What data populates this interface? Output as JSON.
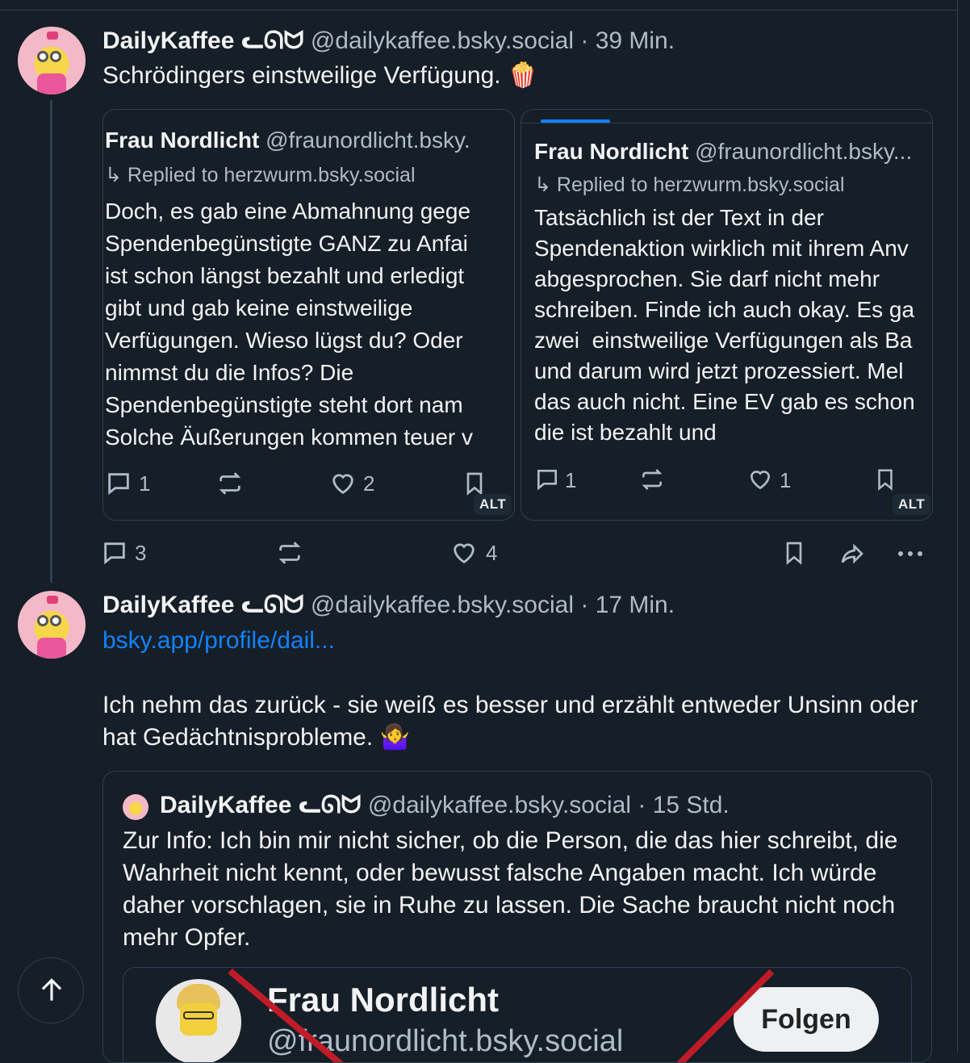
{
  "post1": {
    "author_name": "DailyKaffee ᓚᘏᗢ",
    "handle": "@dailykaffee.bsky.social",
    "separator": "·",
    "time": "39 Min.",
    "text": "Schrödingers einstweilige Verfügung.",
    "emoji": "🍿",
    "images": [
      {
        "author": "Frau Nordlicht",
        "handle": "@fraunordlicht.bsky.",
        "reply_to": "↳ Replied to herzwurm.bsky.social",
        "text": "Doch, es gab eine Abmahnung gege\nSpendenbegünstigte GANZ zu Anfai\nist schon längst bezahlt und erledigt\ngibt und gab keine einstweilige\nVerfügungen. Wieso lügst du? Oder\nnimmst du die Infos? Die\nSpendenbegünstigte steht dort nam\nSolche Äußerungen kommen teuer v",
        "replies": "1",
        "likes": "2",
        "alt": "ALT"
      },
      {
        "author": "Frau Nordlicht",
        "handle": "@fraunordlicht.bsky...",
        "reply_to": "↳ Replied to herzwurm.bsky.social",
        "text": "Tatsächlich ist der Text in der\nSpendenaktion wirklich mit ihrem Anv\nabgesprochen. Sie darf nicht mehr\nschreiben. Finde ich auch okay. Es ga\nzwei  einstweilige Verfügungen als Ba\nund darum wird jetzt prozessiert. Mel\ndas auch nicht. Eine EV gab es schon\ndie ist bezahlt und",
        "replies": "1",
        "likes": "1",
        "alt": "ALT"
      }
    ],
    "reply_count": "3",
    "like_count": "4"
  },
  "post2": {
    "author_name": "DailyKaffee ᓚᘏᗢ",
    "handle": "@dailykaffee.bsky.social",
    "separator": "·",
    "time": "17 Min.",
    "link": "bsky.app/profile/dail...",
    "text": "Ich nehm das zurück - sie weiß es besser und erzählt entweder Unsinn oder hat Gedächtnisprobleme.",
    "emoji": "🤷‍♀️",
    "quote": {
      "author_name": "DailyKaffee ᓚᘏᗢ",
      "handle": "@dailykaffee.bsky.social",
      "separator": "·",
      "time": "15 Std.",
      "text": "Zur Info: Ich bin mir nicht sicher, ob die Person, die das hier schreibt, die Wahrheit nicht kennt, oder bewusst falsche Angaben macht. Ich würde daher vorschlagen, sie in Ruhe zu lassen. Die Sache braucht nicht noch mehr Opfer.",
      "image": {
        "name": "Frau Nordlicht",
        "handle": "@fraunordlicht.bsky.social",
        "follow_label": "Folgen"
      }
    }
  },
  "colors": {
    "background": "#161e27",
    "border": "#2e4052",
    "muted_text": "#aebbc9",
    "link": "#1083fe",
    "strike": "#c01c28"
  },
  "icons": [
    "reply-icon",
    "repost-icon",
    "like-icon",
    "bookmark-icon",
    "share-icon",
    "more-icon",
    "arrow-up-icon"
  ]
}
